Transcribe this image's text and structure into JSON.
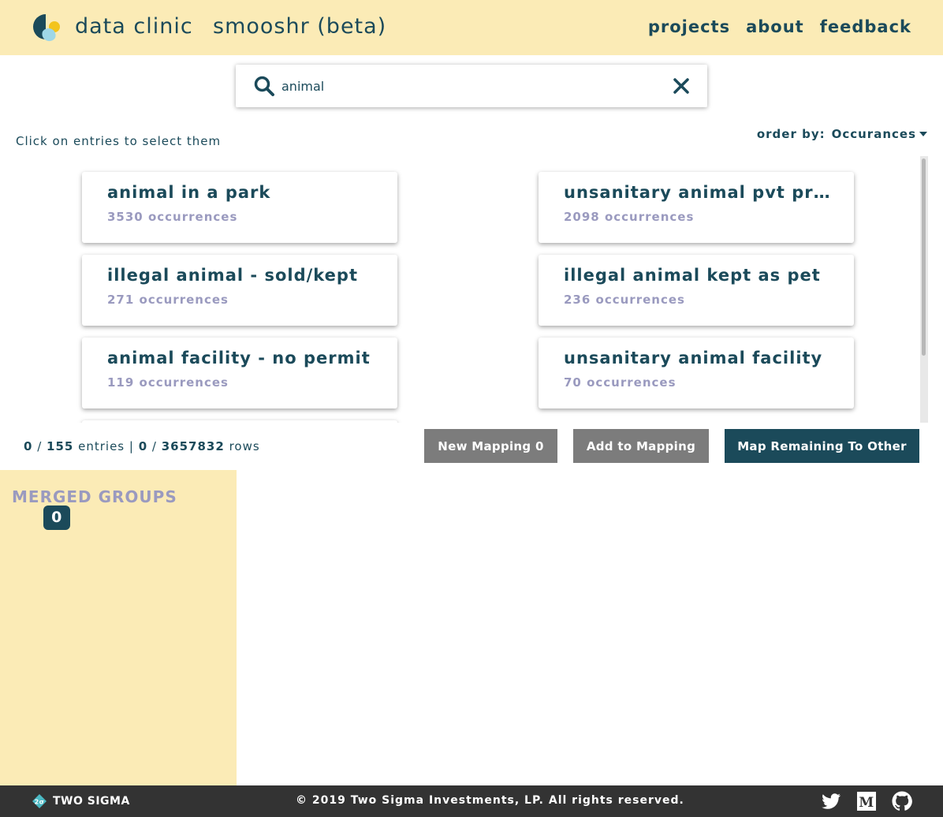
{
  "header": {
    "brand": "data clinic",
    "app_title": "smooshr (beta)",
    "nav": [
      "projects",
      "about",
      "feedback"
    ]
  },
  "search": {
    "value": "animal",
    "icon": "search-icon",
    "clear_icon": "close-icon"
  },
  "hint": "Click on entries to select them",
  "order_by": {
    "label": "order by:",
    "selected": "Occurances"
  },
  "entries": [
    {
      "title": "animal in a park",
      "count": "3530 occurrences"
    },
    {
      "title": "unsanitary animal pvt property",
      "count": "2098 occurrences"
    },
    {
      "title": "illegal animal - sold/kept",
      "count": "271 occurrences"
    },
    {
      "title": "illegal animal kept as pet",
      "count": "236 occurrences"
    },
    {
      "title": "animal facility - no permit",
      "count": "119 occurrences"
    },
    {
      "title": "unsanitary animal facility",
      "count": "70 occurrences"
    }
  ],
  "counts": {
    "selected_entries": "0",
    "total_entries": "155",
    "entries_word": "entries",
    "selected_rows": "0",
    "total_rows": "3657832",
    "rows_word": "rows"
  },
  "buttons": {
    "new_mapping": "New Mapping 0",
    "add_to_mapping": "Add to Mapping",
    "map_remaining": "Map Remaining To Other"
  },
  "merged_groups": {
    "title": "MERGED GROUPS",
    "count": "0"
  },
  "footer": {
    "company": "TWO SIGMA",
    "copyright": "© 2019 Two Sigma Investments, LP. All rights reserved.",
    "social": [
      "twitter-icon",
      "medium-icon",
      "github-icon"
    ]
  },
  "colors": {
    "primary": "#1b4a5a",
    "cream": "#fbebb6",
    "muted": "#9a9abf",
    "button_gray": "#7c7c7c",
    "footer": "#333333"
  }
}
